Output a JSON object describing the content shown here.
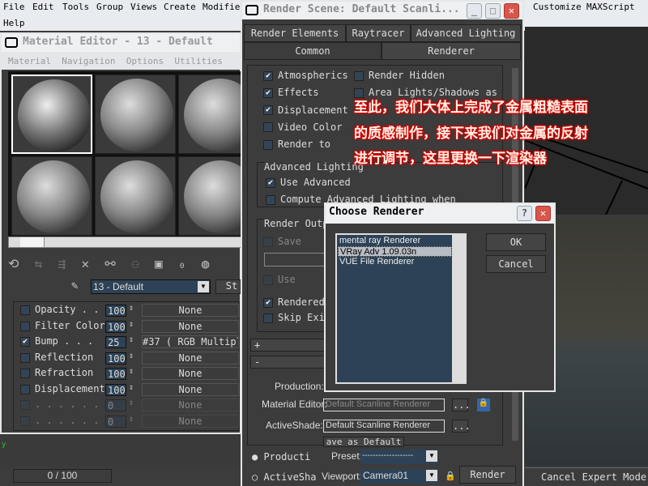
{
  "menu": {
    "items": [
      "File",
      "Edit",
      "Tools",
      "Group",
      "Views",
      "Create",
      "Modifie",
      "Help"
    ],
    "right_items": [
      "Customize",
      "MAXScript"
    ]
  },
  "material_editor": {
    "title": "Material Editor - 13 - Default",
    "menu": [
      "Material",
      "Navigation",
      "Options",
      "Utilities"
    ],
    "material_name": "13 - Default",
    "side_button": "St",
    "maps": [
      {
        "label": "Opacity . .",
        "amount": "100",
        "map": "None",
        "checked": false,
        "enabled": true
      },
      {
        "label": "Filter Color",
        "amount": "100",
        "map": "None",
        "checked": false,
        "enabled": true
      },
      {
        "label": "Bump . . .",
        "amount": "25",
        "map": "#37  ( RGB Multipl",
        "checked": true,
        "enabled": true
      },
      {
        "label": "Reflection",
        "amount": "100",
        "map": "None",
        "checked": false,
        "enabled": true
      },
      {
        "label": "Refraction",
        "amount": "100",
        "map": "None",
        "checked": false,
        "enabled": true
      },
      {
        "label": "Displacement",
        "amount": "100",
        "map": "None",
        "checked": false,
        "enabled": true
      },
      {
        "label": ". . . . . .",
        "amount": "0",
        "map": "None",
        "checked": false,
        "enabled": false
      },
      {
        "label": ". . . . . .",
        "amount": "0",
        "map": "None",
        "checked": false,
        "enabled": false
      }
    ]
  },
  "timeline": {
    "frame": "0 / 100"
  },
  "render_scene": {
    "title": "Render Scene: Default Scanli...",
    "tabs_row1": [
      "Render Elements",
      "Raytracer",
      "Advanced Lighting"
    ],
    "tabs_row2": [
      "Common",
      "Renderer"
    ],
    "options_left": [
      {
        "label": "Atmospherics",
        "checked": true
      },
      {
        "label": "Effects",
        "checked": true
      },
      {
        "label": "Displacement",
        "checked": true
      },
      {
        "label": "Video Color",
        "checked": false
      },
      {
        "label": "Render to",
        "checked": false
      }
    ],
    "options_right": [
      {
        "label": "Render Hidden",
        "checked": false
      },
      {
        "label": "Area Lights/Shadows as",
        "checked": false
      }
    ],
    "adv_lighting_group": "Advanced Lighting",
    "adv_options": [
      {
        "label": "Use Advanced",
        "checked": true
      },
      {
        "label": "Compute Advanced Lighting when",
        "checked": false
      }
    ],
    "render_output_group": "Render Outp",
    "output_options": [
      {
        "label": "Save",
        "checked": false
      },
      {
        "label": "Use",
        "checked": false
      },
      {
        "label": "Rendered",
        "checked": true
      },
      {
        "label": "Skip Exi",
        "checked": false
      }
    ],
    "rollout_plus": "+",
    "rollout_minus": "-",
    "production_label": "Production:",
    "material_editor_label": "Material Editor:",
    "material_editor_value": "Default Scanline Renderer",
    "activeshade_label": "ActiveShade:",
    "activeshade_value": "Default Scanline Renderer",
    "save_default": "ave as Default",
    "dots": "...",
    "radio_production": "Producti",
    "radio_activeshade": "ActiveSha",
    "preset_label": "Preset:",
    "preset_value": "-------------------",
    "viewport_label": "Viewport:",
    "viewport_value": "Camera01",
    "render_button": "Render"
  },
  "dialog": {
    "title": "Choose Renderer",
    "help": "?",
    "items": [
      "mental ray Renderer",
      "VRay Adv 1.09.03n",
      "VUE File Renderer"
    ],
    "selected": 1,
    "ok": "OK",
    "cancel": "Cancel"
  },
  "status": {
    "text": "Cancel Expert Mode"
  },
  "caption": [
    "至此，我们大体上完成了金属粗糙表面",
    "的质感制作，接下来我们对金属的反射",
    "进行调节，这里更换一下渲染器"
  ]
}
